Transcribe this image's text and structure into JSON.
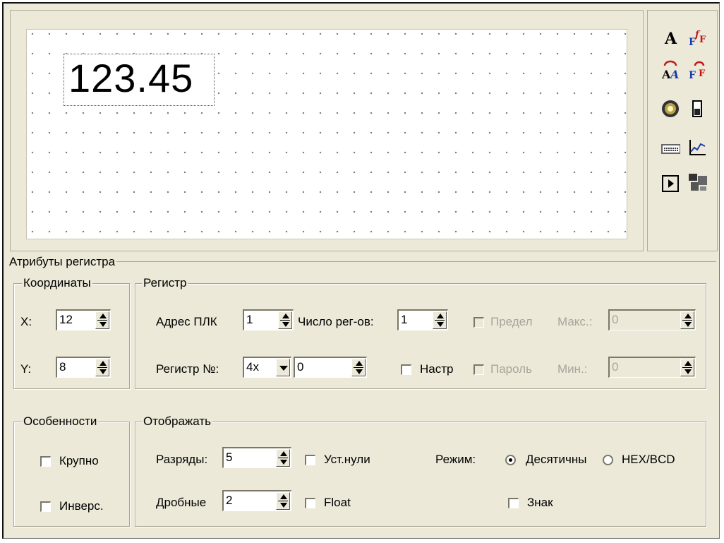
{
  "preview": {
    "value": "123.45"
  },
  "toolbar": {
    "icons": [
      "text-icon",
      "font-size-icon",
      "rotate-text-icon",
      "rotate-font-icon",
      "lamp-icon",
      "level-icon",
      "keypad-icon",
      "trend-icon",
      "play-icon",
      "settings-icon"
    ]
  },
  "attributes": {
    "title": "Атрибуты регистра"
  },
  "coords": {
    "title": "Координаты",
    "x_label": "X:",
    "x_value": "12",
    "y_label": "Y:",
    "y_value": "8"
  },
  "register": {
    "title": "Регистр",
    "plc_addr_label": "Адрес ПЛК",
    "plc_addr_value": "1",
    "reg_count_label": "Число рег-ов:",
    "reg_count_value": "1",
    "limit_label": "Предел",
    "max_label": "Макс.:",
    "max_value": "0",
    "reg_num_label": "Регистр №:",
    "reg_type_value": "4x",
    "reg_num_value": "0",
    "setup_label": "Настр",
    "password_label": "Пароль",
    "min_label": "Мин.:",
    "min_value": "0"
  },
  "features": {
    "title": "Особенности",
    "large_label": "Крупно",
    "invert_label": "Инверс."
  },
  "display": {
    "title": "Отображать",
    "digits_label": "Разряды:",
    "digits_value": "5",
    "zeros_label": "Уст.нули",
    "mode_label": "Режим:",
    "decimal_label": "Десятичны",
    "hex_label": "HEX/BCD",
    "fraction_label": "Дробные",
    "fraction_value": "2",
    "float_label": "Float",
    "sign_label": "Знак"
  }
}
